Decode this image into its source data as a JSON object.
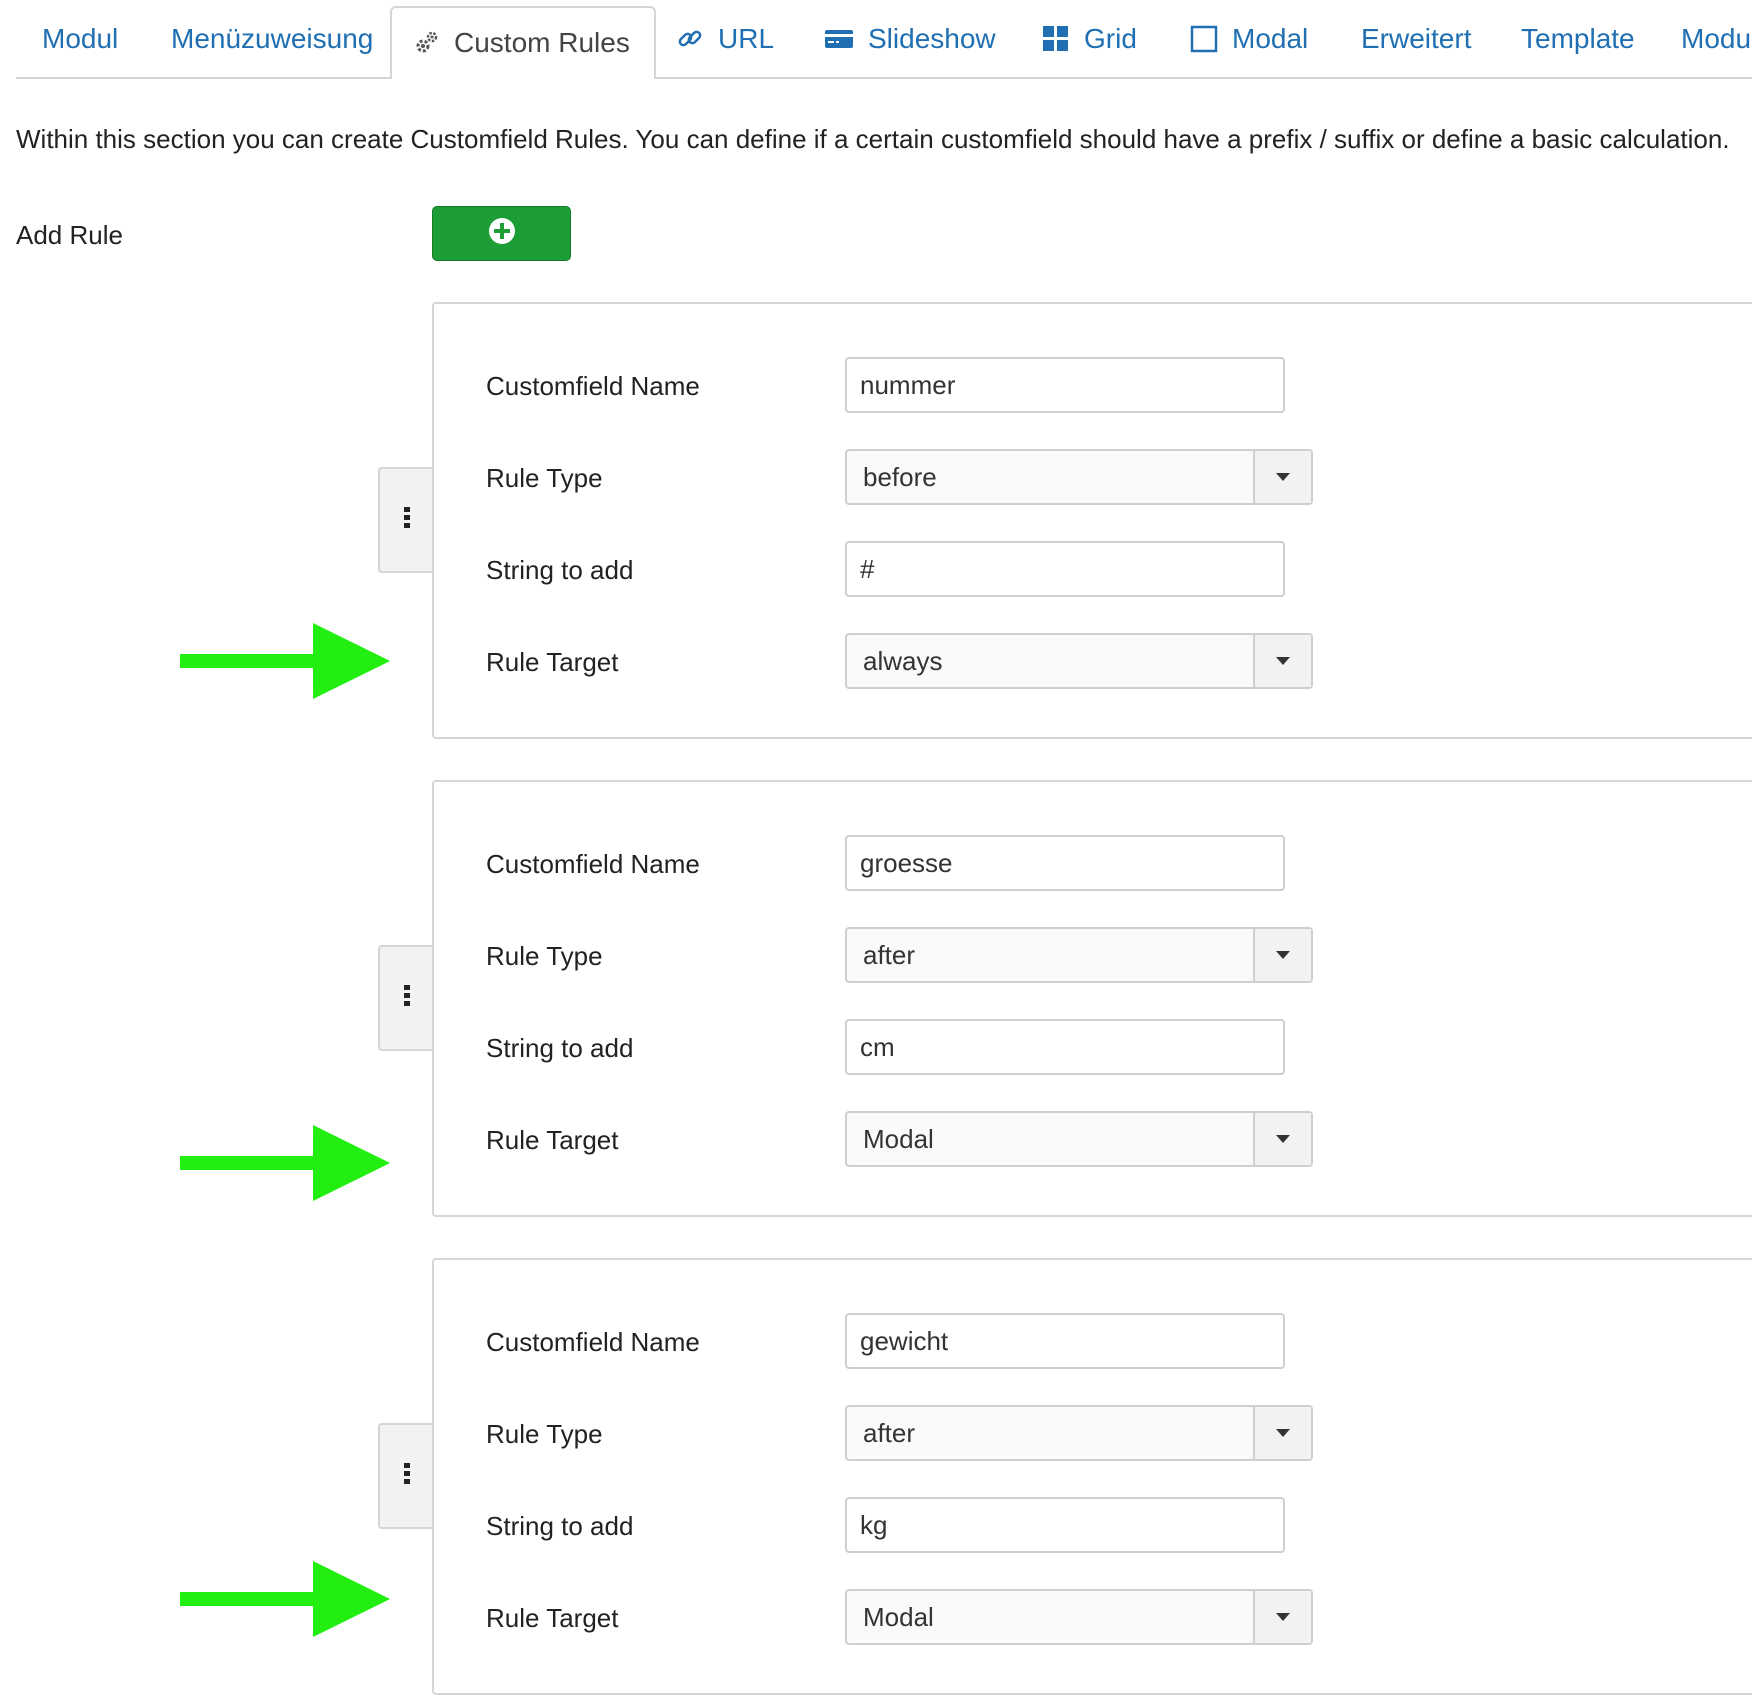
{
  "tabs": [
    {
      "label": "Modul",
      "icon": ""
    },
    {
      "label": "Menüzuweisung",
      "icon": ""
    },
    {
      "label": "Custom Rules",
      "icon": "gears-icon",
      "active": true
    },
    {
      "label": "URL",
      "icon": "link-icon"
    },
    {
      "label": "Slideshow",
      "icon": "credit-card-icon"
    },
    {
      "label": "Grid",
      "icon": "grid-icon"
    },
    {
      "label": "Modal",
      "icon": "square-icon"
    },
    {
      "label": "Erweitert",
      "icon": ""
    },
    {
      "label": "Template",
      "icon": ""
    },
    {
      "label": "Modul",
      "icon": ""
    }
  ],
  "intro_text": "Within this section you can create Customfield Rules. You can define if a certain customfield should have a prefix / suffix or define a basic calculation.",
  "add_rule": {
    "label": "Add Rule",
    "button_icon": "plus-circle-icon",
    "button_color": "#1c9d36"
  },
  "field_labels": {
    "name": "Customfield Name",
    "type": "Rule Type",
    "string": "String to add",
    "target": "Rule Target"
  },
  "rules": [
    {
      "name": "nummer",
      "type": "before",
      "string": "#",
      "target": "always"
    },
    {
      "name": "groesse",
      "type": "after",
      "string": "cm",
      "target": "Modal"
    },
    {
      "name": "gewicht",
      "type": "after",
      "string": "kg",
      "target": "Modal"
    }
  ],
  "annotation_arrow_color": "#22ee11",
  "colors": {
    "link": "#1f6fb2",
    "border": "#d6d6d6"
  }
}
